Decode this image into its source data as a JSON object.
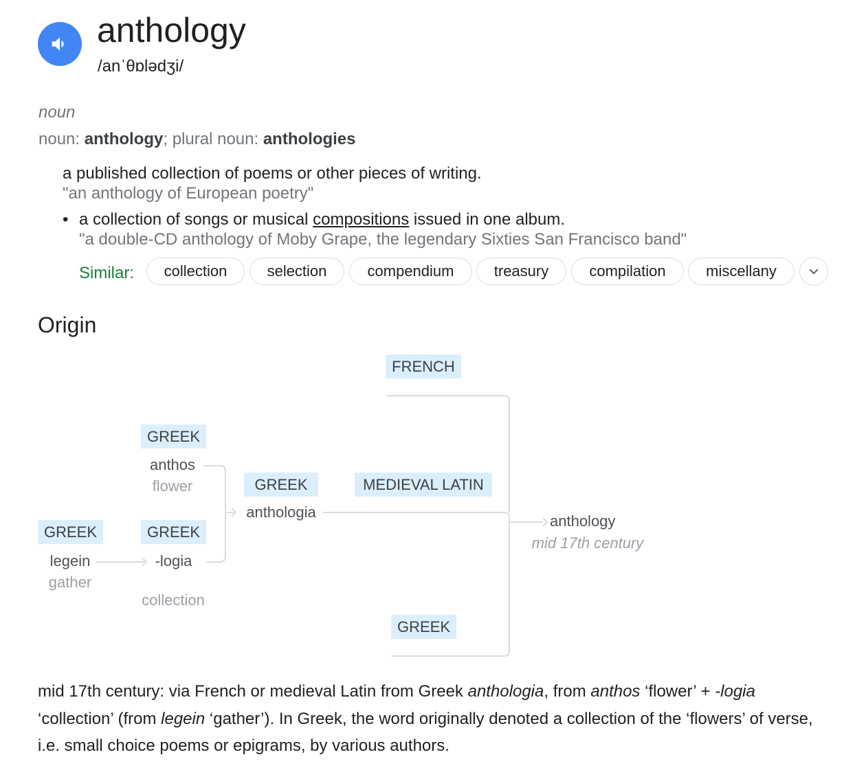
{
  "entry": {
    "word": "anthology",
    "phonetic": "/anˈθɒlədʒi/",
    "speaker_icon": "speaker-icon"
  },
  "sense": {
    "part_of_speech": "noun",
    "forms_prefix": "noun: ",
    "forms_word": "anthology",
    "forms_sep": "; plural noun: ",
    "forms_plural": "anthologies"
  },
  "definitions": [
    {
      "text": "a published collection of poems or other pieces of writing.",
      "example": "\"an anthology of European poetry\""
    },
    {
      "bullet": "•",
      "text_before": "a collection of songs or musical ",
      "link": "compositions",
      "text_after": " issued in one album.",
      "example": "\"a double-CD anthology of Moby Grape, the legendary Sixties San Francisco band\""
    }
  ],
  "similar": {
    "label": "Similar:",
    "chips": [
      "collection",
      "selection",
      "compendium",
      "treasury",
      "compilation",
      "miscellany"
    ],
    "more_icon": "chevron-down-icon"
  },
  "origin": {
    "title": "Origin",
    "nodes": {
      "french_tag": "FRENCH",
      "medieval_latin_tag": "MEDIEVAL LATIN",
      "greek_bottom_tag": "GREEK",
      "greek_anthos_tag": "GREEK",
      "anthos": "anthos",
      "anthos_gloss": "flower",
      "greek_logia_tag": "GREEK",
      "logia": "-logia",
      "logia_gloss": "collection",
      "greek_legein_tag": "GREEK",
      "legein": "legein",
      "legein_gloss": "gather",
      "greek_anthologia_tag": "GREEK",
      "anthologia": "anthologia",
      "result": "anthology",
      "result_date": "mid 17th century"
    },
    "text": {
      "p1": "mid 17th century: via French or medieval Latin from Greek ",
      "i1": "anthologia",
      "p2": ", from ",
      "i2": "anthos",
      "p3": " ‘flower’ + ",
      "i3": "-logia",
      "p4": " ‘collection’ (from ",
      "i4": "legein",
      "p5": " ‘gather’). In Greek, the word originally denoted a collection of the ‘flowers’ of verse, i.e. small choice poems or epigrams, by various authors."
    }
  }
}
